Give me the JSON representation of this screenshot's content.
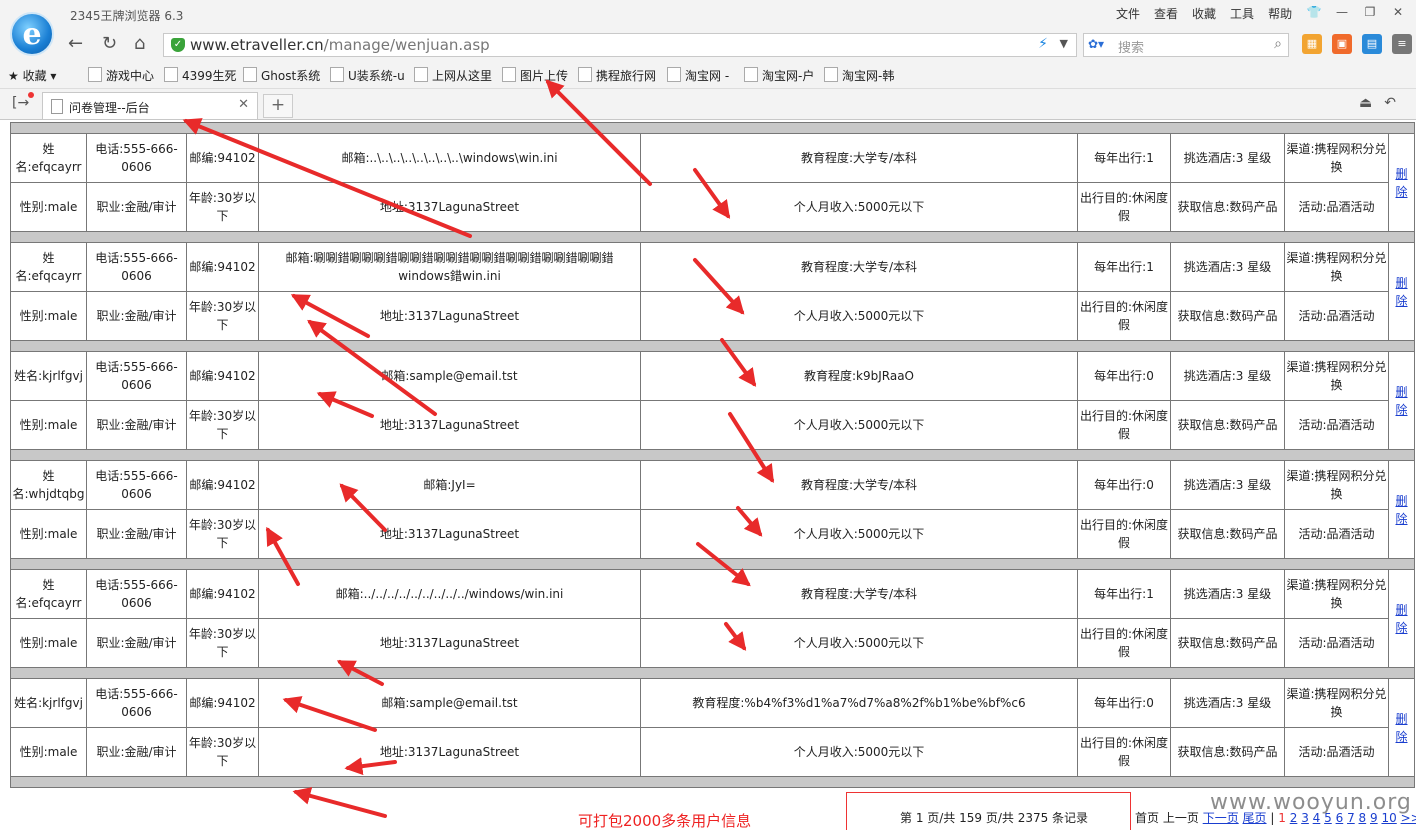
{
  "app_title": "2345王牌浏览器 6.3",
  "menu": [
    "文件",
    "查看",
    "收藏",
    "工具",
    "帮助"
  ],
  "url_host": "www.etraveller.cn",
  "url_path": "/manage/wenjuan.asp",
  "search_placeholder": "搜索",
  "bookmarks_label": "收藏",
  "bookmarks": [
    "游戏中心",
    "4399生死",
    "Ghost系统",
    "U装系统-u",
    "上网从这里",
    "图片上传",
    "携程旅行网",
    "淘宝网 -",
    "淘宝网-户",
    "淘宝网-韩"
  ],
  "tab_title": "问卷管理--后台",
  "records": [
    {
      "row1": [
        "姓名:efqcayrr",
        "电话:555-666-0606",
        "邮编:94102",
        "邮箱:..\\..\\..\\..\\..\\..\\..\\..\\windows\\win.ini",
        "教育程度:大学专/本科",
        "每年出行:1",
        "挑选酒店:3 星级",
        "渠道:携程网积分兑换"
      ],
      "row2": [
        "性别:male",
        "职业:金融/审计",
        "年龄:30岁以下",
        "地址:3137LagunaStreet",
        "个人月收入:5000元以下",
        "出行目的:休闲度假",
        "获取信息:数码产品",
        "活动:品酒活动"
      ]
    },
    {
      "row1": [
        "姓名:efqcayrr",
        "电话:555-666-0606",
        "邮编:94102",
        "邮箱:唰唰錯唰唰唰錯唰唰錯唰唰錯唰唰錯唰唰錯唰唰錯唰唰錯windows錯win.ini",
        "教育程度:大学专/本科",
        "每年出行:1",
        "挑选酒店:3 星级",
        "渠道:携程网积分兑换"
      ],
      "row2": [
        "性别:male",
        "职业:金融/审计",
        "年龄:30岁以下",
        "地址:3137LagunaStreet",
        "个人月收入:5000元以下",
        "出行目的:休闲度假",
        "获取信息:数码产品",
        "活动:品酒活动"
      ]
    },
    {
      "row1": [
        "姓名:kjrlfgvj",
        "电话:555-666-0606",
        "邮编:94102",
        "邮箱:sample@email.tst",
        "教育程度:k9bJRaaO",
        "每年出行:0",
        "挑选酒店:3 星级",
        "渠道:携程网积分兑换"
      ],
      "row2": [
        "性别:male",
        "职业:金融/审计",
        "年龄:30岁以下",
        "地址:3137LagunaStreet",
        "个人月收入:5000元以下",
        "出行目的:休闲度假",
        "获取信息:数码产品",
        "活动:品酒活动"
      ]
    },
    {
      "row1": [
        "姓名:whjdtqbg",
        "电话:555-666-0606",
        "邮编:94102",
        "邮箱:JyI=",
        "教育程度:大学专/本科",
        "每年出行:0",
        "挑选酒店:3 星级",
        "渠道:携程网积分兑换"
      ],
      "row2": [
        "性别:male",
        "职业:金融/审计",
        "年龄:30岁以下",
        "地址:3137LagunaStreet",
        "个人月收入:5000元以下",
        "出行目的:休闲度假",
        "获取信息:数码产品",
        "活动:品酒活动"
      ]
    },
    {
      "row1": [
        "姓名:efqcayrr",
        "电话:555-666-0606",
        "邮编:94102",
        "邮箱:../../../../../../../../../windows/win.ini",
        "教育程度:大学专/本科",
        "每年出行:1",
        "挑选酒店:3 星级",
        "渠道:携程网积分兑换"
      ],
      "row2": [
        "性别:male",
        "职业:金融/审计",
        "年龄:30岁以下",
        "地址:3137LagunaStreet",
        "个人月收入:5000元以下",
        "出行目的:休闲度假",
        "获取信息:数码产品",
        "活动:品酒活动"
      ]
    },
    {
      "row1": [
        "姓名:kjrlfgvj",
        "电话:555-666-0606",
        "邮编:94102",
        "邮箱:sample@email.tst",
        "教育程度:%b4%f3%d1%a7%d7%a8%2f%b1%be%bf%c6",
        "每年出行:0",
        "挑选酒店:3 星级",
        "渠道:携程网积分兑换"
      ],
      "row2": [
        "性别:male",
        "职业:金融/审计",
        "年龄:30岁以下",
        "地址:3137LagunaStreet",
        "个人月收入:5000元以下",
        "出行目的:休闲度假",
        "获取信息:数码产品",
        "活动:品酒活动"
      ]
    }
  ],
  "delete_label": "删除",
  "pager": {
    "summary": "第 1 页/共 159 页/共 2375 条记录",
    "first": "首页",
    "prev": "上一页",
    "next": "下一页",
    "last": "尾页",
    "sep": "|",
    "current": "1",
    "pages": [
      "2",
      "3",
      "4",
      "5",
      "6",
      "7",
      "8",
      "9",
      "10"
    ],
    "more": ">>"
  },
  "annotation": "可打包2000多条用户信息",
  "watermark": "www.wooyun.org"
}
